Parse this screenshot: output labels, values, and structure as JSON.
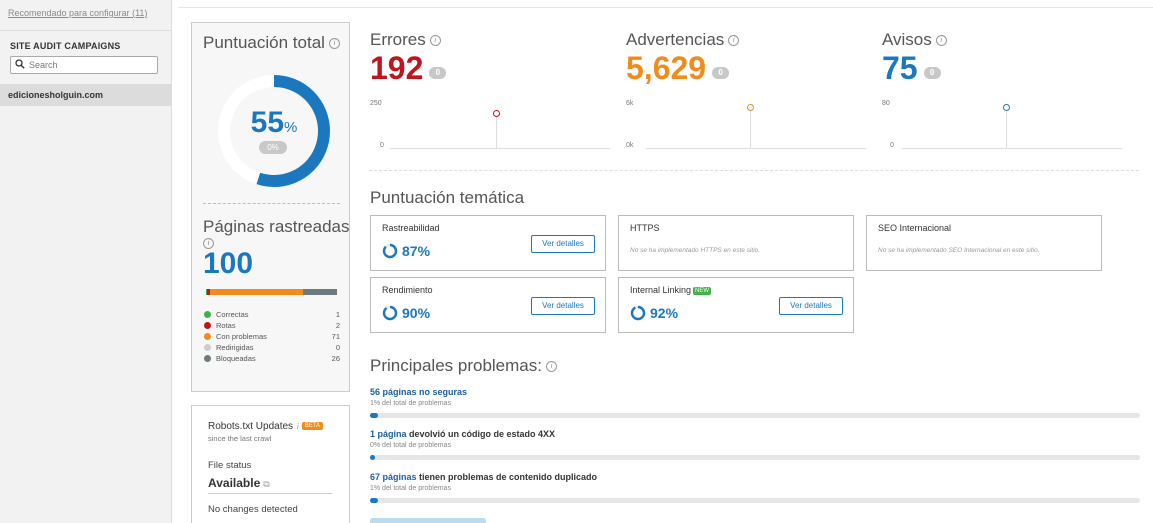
{
  "sidebar": {
    "recommended_link": "Recomendado para configurar (11)",
    "campaigns_title": "SITE AUDIT CAMPAIGNS",
    "search_placeholder": "Search",
    "site_name": "edicionesholguin.com"
  },
  "score": {
    "title": "Puntuación total",
    "value": "55",
    "unit": "%",
    "change": "0%",
    "fill_fraction": 0.55,
    "color": "#1b78bf"
  },
  "pages": {
    "title": "Páginas rastreadas",
    "value": "100",
    "legend": [
      {
        "label": "Correctas",
        "count": "1",
        "color": "#3eb349"
      },
      {
        "label": "Rotas",
        "count": "2",
        "color": "#c0141e"
      },
      {
        "label": "Con problemas",
        "count": "71",
        "color": "#f08c1e"
      },
      {
        "label": "Redirigidas",
        "count": "0",
        "color": "#cccccc"
      },
      {
        "label": "Bloqueadas",
        "count": "26",
        "color": "#6e7a80"
      }
    ]
  },
  "robots": {
    "title": "Robots.txt Updates",
    "info_icon": "i",
    "beta_badge": "BETA",
    "subtitle": "since the last crawl",
    "file_status_label": "File status",
    "file_status_value": "Available",
    "no_changes": "No changes detected"
  },
  "metrics": [
    {
      "title": "Errores",
      "value": "192",
      "badge": "0",
      "color": "#c0141e",
      "y_top": "250",
      "y_bottom": "0"
    },
    {
      "title": "Advertencias",
      "value": "5,629",
      "badge": "0",
      "color": "#f08c1e",
      "y_top": "6k",
      "y_bottom": "0k"
    },
    {
      "title": "Avisos",
      "value": "75",
      "badge": "0",
      "color": "#1b78bf",
      "y_top": "80",
      "y_bottom": "0"
    }
  ],
  "thematic": {
    "title": "Puntuación temática",
    "cards": [
      {
        "title": "Rastreabilidad",
        "value": "87%",
        "button": "Ver detalles"
      },
      {
        "title": "HTTPS",
        "message": "No se ha implementado HTTPS en este sitio."
      },
      {
        "title": "SEO Internacional",
        "message": "No se ha implementado SEO Internacional en este sitio."
      },
      {
        "title": "Rendimiento",
        "value": "90%",
        "button": "Ver detalles"
      },
      {
        "title": "Internal Linking",
        "new_badge": "NEW",
        "value": "92%",
        "button": "Ver detalles"
      }
    ]
  },
  "problems": {
    "title": "Principales problemas:",
    "items": [
      {
        "link": "56 páginas no seguras",
        "rest": "",
        "sub": "1% del total de problemas",
        "fraction": 0.01
      },
      {
        "link": "1 página",
        "rest": " devolvió un código de estado 4XX",
        "sub": "0% del total de problemas",
        "fraction": 0.0
      },
      {
        "link": "67 páginas",
        "rest": " tienen problemas de contenido duplicado",
        "sub": "1% del total de problemas",
        "fraction": 0.01
      }
    ]
  }
}
